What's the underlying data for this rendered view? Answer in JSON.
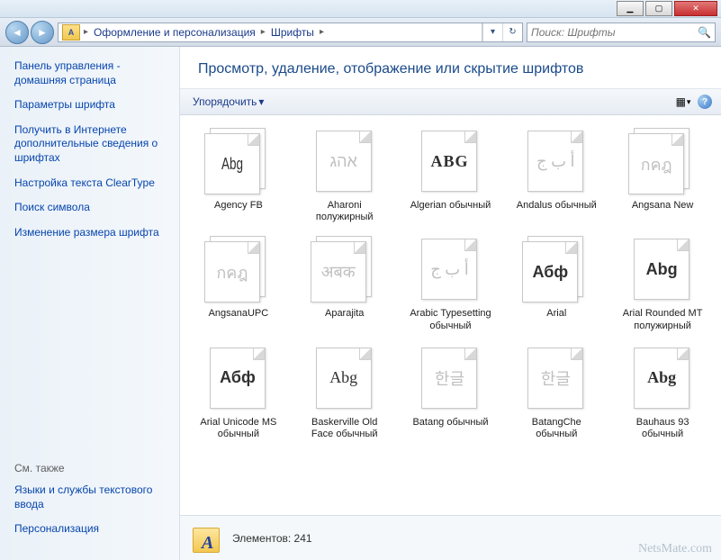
{
  "titlebar": {
    "min": "▁",
    "max": "▢",
    "close": "✕"
  },
  "nav": {
    "back": "◄",
    "fwd": "►"
  },
  "breadcrumbs": [
    "Оформление и персонализация",
    "Шрифты"
  ],
  "addr": {
    "sep": "▸",
    "dropdown": "▾",
    "refresh": "↻"
  },
  "search": {
    "placeholder": "Поиск: Шрифты",
    "icon": "🔍"
  },
  "sidebar": {
    "links_top": [
      "Панель управления - домашняя страница",
      "Параметры шрифта",
      "Получить в Интернете дополнительные сведения о шрифтах",
      "Настройка текста ClearType",
      "Поиск символа",
      "Изменение размера шрифта"
    ],
    "see_also_header": "См. также",
    "links_bottom": [
      "Языки и службы текстового ввода",
      "Персонализация"
    ]
  },
  "main": {
    "title": "Просмотр, удаление, отображение или скрытие шрифтов",
    "organize": "Упорядочить",
    "dropdown": "▾",
    "viewicon": "▦",
    "help": "?"
  },
  "fonts": [
    {
      "name": "Agency FB",
      "sample": "Abg",
      "dim": false,
      "family": "sans-condensed",
      "multi": true
    },
    {
      "name": "Aharoni полужирный",
      "sample": "אהג",
      "dim": true,
      "family": "sans",
      "multi": false
    },
    {
      "name": "Algerian обычный",
      "sample": "ABG",
      "dim": false,
      "family": "serif-cap",
      "multi": false
    },
    {
      "name": "Andalus обычный",
      "sample": "أ ب ج",
      "dim": true,
      "family": "arabic",
      "multi": false
    },
    {
      "name": "Angsana New",
      "sample": "กคฎ",
      "dim": true,
      "family": "thai",
      "multi": true
    },
    {
      "name": "AngsanaUPC",
      "sample": "กคฎ",
      "dim": true,
      "family": "thai",
      "multi": true
    },
    {
      "name": "Aparajita",
      "sample": "अबक",
      "dim": true,
      "family": "devanagari",
      "multi": true
    },
    {
      "name": "Arabic Typesetting обычный",
      "sample": "أ ب ج",
      "dim": true,
      "family": "arabic",
      "multi": false
    },
    {
      "name": "Arial",
      "sample": "Абф",
      "dim": false,
      "family": "arial",
      "multi": true
    },
    {
      "name": "Arial Rounded MT полужирный",
      "sample": "Abg",
      "dim": false,
      "family": "arial-bold",
      "multi": false
    },
    {
      "name": "Arial Unicode MS обычный",
      "sample": "Абф",
      "dim": false,
      "family": "arial",
      "multi": false
    },
    {
      "name": "Baskerville Old Face обычный",
      "sample": "Abg",
      "dim": false,
      "family": "serif",
      "multi": false
    },
    {
      "name": "Batang обычный",
      "sample": "한글",
      "dim": true,
      "family": "korean",
      "multi": false
    },
    {
      "name": "BatangChe обычный",
      "sample": "한글",
      "dim": true,
      "family": "korean",
      "multi": false
    },
    {
      "name": "Bauhaus 93 обычный",
      "sample": "Abg",
      "dim": false,
      "family": "bauhaus",
      "multi": false
    }
  ],
  "status": {
    "label": "Элементов: 241"
  },
  "watermark": "NetsMate.com"
}
